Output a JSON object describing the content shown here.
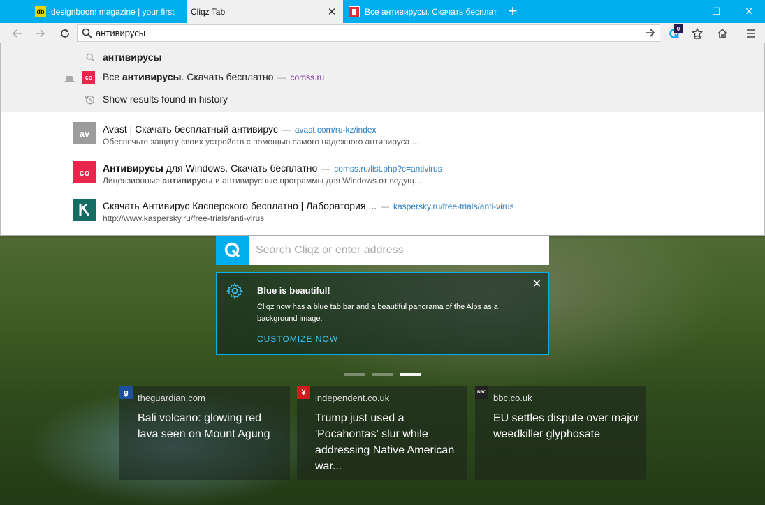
{
  "tabs": [
    {
      "title": "designboom magazine | your first",
      "favicon_text": "db",
      "favicon_color": "#e7d600"
    },
    {
      "title": "Cliqz Tab",
      "active": true
    },
    {
      "title": "Все антивирусы. Скачать бесплат",
      "favicon_text": "",
      "favicon_color": "#e03030"
    }
  ],
  "window_controls": {
    "minimize": "—",
    "maximize": "☐",
    "close": "✕"
  },
  "urlbar": {
    "value": "антивирусы"
  },
  "toolbar": {
    "cliqz_badge": "0"
  },
  "dropdown": {
    "query_suggestion": "антивирусы",
    "history_item": {
      "title_pre": "Все ",
      "title_bold": "антивирусы",
      "title_post": ". Скачать бесплатно",
      "sep": "—",
      "url": "comss.ru",
      "favicon_text": "co"
    },
    "show_history": "Show results found in history",
    "results": [
      {
        "logo": "av",
        "logo_color": "#9c9c9c",
        "title_bold": "",
        "title_rest": "Avast | Скачать бесплатный антивирус",
        "sep": "—",
        "url": "avast.com/ru-kz/index",
        "desc_pre": "Обеспечьте защиту своих устройств с помощью самого надежного антивируса ...",
        "desc_bold": "",
        "desc_post": ""
      },
      {
        "logo": "co",
        "logo_color": "#e8254a",
        "title_bold": "Антивирусы",
        "title_rest": " для Windows. Скачать бесплатно",
        "sep": "—",
        "url": "comss.ru/list.php?c=antivirus",
        "desc_pre": "Лицензионные ",
        "desc_bold": "антивирусы",
        "desc_post": " и антивирусные программы для Windows от ведущ..."
      },
      {
        "logo": "K",
        "logo_color": "#146c63",
        "title_bold": "",
        "title_rest": "Скачать Антивирус Касперского бесплатно | Лаборатория ...",
        "sep": "—",
        "url": "kaspersky.ru/free-trials/anti-virus",
        "desc_pre": "http://www.kaspersky.ru/free-trials/anti-virus",
        "desc_bold": "",
        "desc_post": ""
      }
    ]
  },
  "cliqz": {
    "search_placeholder": "Search Cliqz or enter address",
    "notice": {
      "title": "Blue is beautiful!",
      "body": "Cliqz now has a blue tab bar and a beautiful panorama of the Alps as a background image.",
      "cta": "CUSTOMIZE NOW"
    },
    "news": [
      {
        "source": "theguardian.com",
        "icon": "g",
        "icon_bg": "#1c4f9c",
        "headline": "Bali volcano: glowing red lava seen on Mount Agung"
      },
      {
        "source": "independent.co.uk",
        "icon": "¥",
        "icon_bg": "#cc1c1c",
        "headline": "Trump just used a 'Pocahontas' slur while addressing Native American war..."
      },
      {
        "source": "bbc.co.uk",
        "icon": "BBC",
        "icon_bg": "#222222",
        "headline": "EU settles dispute over major weedkiller glyphosate"
      }
    ]
  }
}
